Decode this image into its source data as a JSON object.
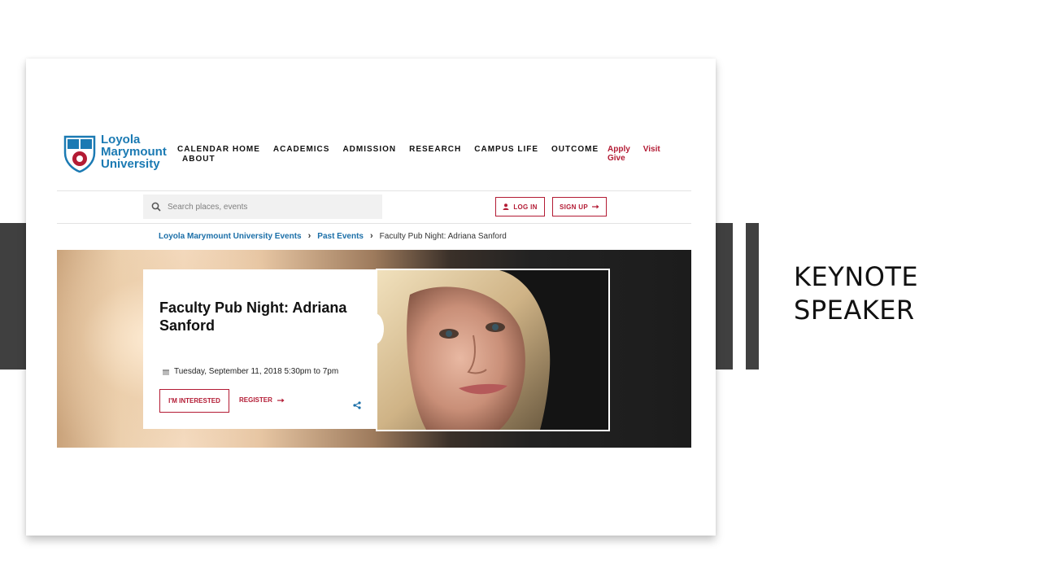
{
  "slide": {
    "title": "KEYNOTE SPEAKER"
  },
  "logo": {
    "line1": "Loyola",
    "line2": "Marymount",
    "line3": "University"
  },
  "nav": {
    "items": [
      "CALENDAR HOME",
      "ACADEMICS",
      "ADMISSION",
      "RESEARCH",
      "CAMPUS LIFE",
      "OUTCOME"
    ],
    "about": "ABOUT"
  },
  "aux": {
    "apply": "Apply",
    "visit": "Visit",
    "give": "Give"
  },
  "search": {
    "placeholder": "Search places, events"
  },
  "auth": {
    "login": "LOG IN",
    "signup": "SIGN UP"
  },
  "breadcrumb": {
    "items": [
      "Loyola Marymount University Events",
      "Past Events",
      "Faculty Pub Night: Adriana Sanford"
    ]
  },
  "event": {
    "title": "Faculty Pub Night: Adriana Sanford",
    "date": "Tuesday, September 11, 2018 5:30pm to 7pm",
    "interested": "I'M INTERESTED",
    "register": "REGISTER"
  },
  "colors": {
    "brand_blue": "#1b7ab3",
    "brand_red": "#b31b34",
    "deco_gray": "#404040"
  }
}
